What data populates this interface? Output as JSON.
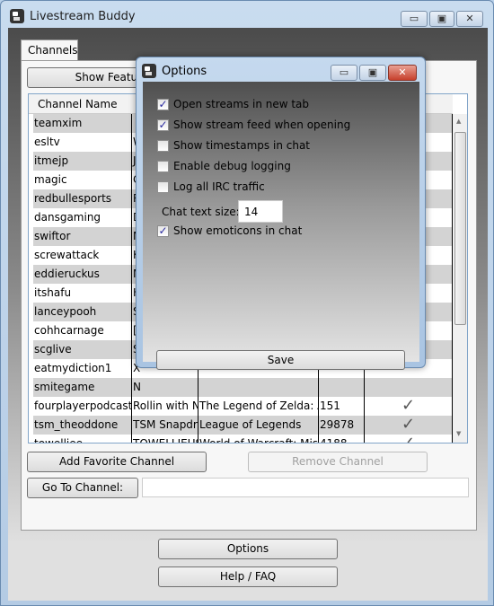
{
  "window": {
    "title": "Livestream Buddy",
    "minimize": "▭",
    "maximize": "▣",
    "close": "✕"
  },
  "tabs": [
    {
      "label": "Channels"
    }
  ],
  "toolbar": {
    "show_featured": "Show Featured Streams"
  },
  "grid": {
    "headers": [
      "Channel Name"
    ],
    "rows": [
      {
        "name": "teamxim",
        "c2": ""
      },
      {
        "name": "esltv",
        "c2": "W"
      },
      {
        "name": "itmejp",
        "c2": "J"
      },
      {
        "name": "magic",
        "c2": "C"
      },
      {
        "name": "redbullesports",
        "c2": "R"
      },
      {
        "name": "dansgaming",
        "c2": "D"
      },
      {
        "name": "swiftor",
        "c2": "M"
      },
      {
        "name": "screwattack",
        "c2": "K"
      },
      {
        "name": "eddieruckus",
        "c2": "M"
      },
      {
        "name": "itshafu",
        "c2": "H"
      },
      {
        "name": "lanceypooh",
        "c2": "S"
      },
      {
        "name": "cohhcarnage",
        "c2": "["
      },
      {
        "name": "scglive",
        "c2": "S"
      },
      {
        "name": "eatmydiction1",
        "c2": "X"
      },
      {
        "name": "smitegame",
        "c2": "N"
      },
      {
        "name": "fourplayerpodcast",
        "c2": "Rollin with No",
        "c3": "The Legend of Zelda: A Link",
        "c4": "151",
        "live": true
      },
      {
        "name": "tsm_theoddone",
        "c2": "TSM Snapdragon",
        "c3": "League of Legends",
        "c4": "29878",
        "live": true
      },
      {
        "name": "towelliee",
        "c2": "TOWELLIEUS",
        "c3": "World of Warcraft: Mists of",
        "c4": "4188",
        "live": true
      }
    ]
  },
  "actions": {
    "add_favorite": "Add Favorite Channel",
    "remove": "Remove Channel",
    "goto": "Go To Channel:",
    "goto_value": ""
  },
  "footer": {
    "options": "Options",
    "help": "Help / FAQ"
  },
  "options_dialog": {
    "title": "Options",
    "checkboxes": [
      {
        "label": "Open streams in new tab",
        "checked": true
      },
      {
        "label": "Show stream feed when opening",
        "checked": true
      },
      {
        "label": "Show timestamps in chat",
        "checked": false
      },
      {
        "label": "Enable debug logging",
        "checked": false
      },
      {
        "label": "Log all IRC traffic",
        "checked": false
      }
    ],
    "chat_text_size_label": "Chat text size:",
    "chat_text_size": "14",
    "emoticons": {
      "label": "Show emoticons in chat",
      "checked": true
    },
    "save": "Save"
  }
}
